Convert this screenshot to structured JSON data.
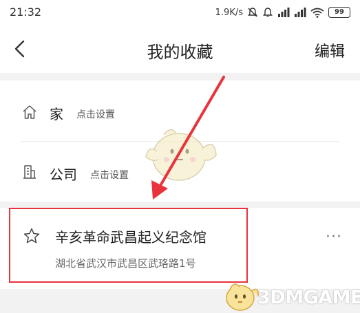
{
  "status_bar": {
    "time": "21:32",
    "speed": "1.9K/s",
    "battery": "99",
    "icons": [
      "mute-icon",
      "alarm-icon",
      "signal-icon",
      "wifi-icon",
      "battery-icon"
    ]
  },
  "header": {
    "back_icon": "back-chevron-icon",
    "title": "我的收藏",
    "edit_label": "编辑"
  },
  "places": [
    {
      "icon": "home-icon",
      "name": "家",
      "action": "点击设置"
    },
    {
      "icon": "building-icon",
      "name": "公司",
      "action": "点击设置"
    }
  ],
  "favorites": [
    {
      "icon": "star-icon",
      "name": "辛亥革命武昌起义纪念馆",
      "address": "湖北省武汉市武昌区武珞路1号",
      "more_icon": "more-dots-icon",
      "more_label": "···"
    }
  ],
  "watermark": {
    "text": "3DMGAME"
  },
  "colors": {
    "background": "#f2f2f2",
    "card": "#ffffff",
    "annotation_red": "#e8333c",
    "text_primary": "#222222",
    "text_secondary": "#666666"
  }
}
